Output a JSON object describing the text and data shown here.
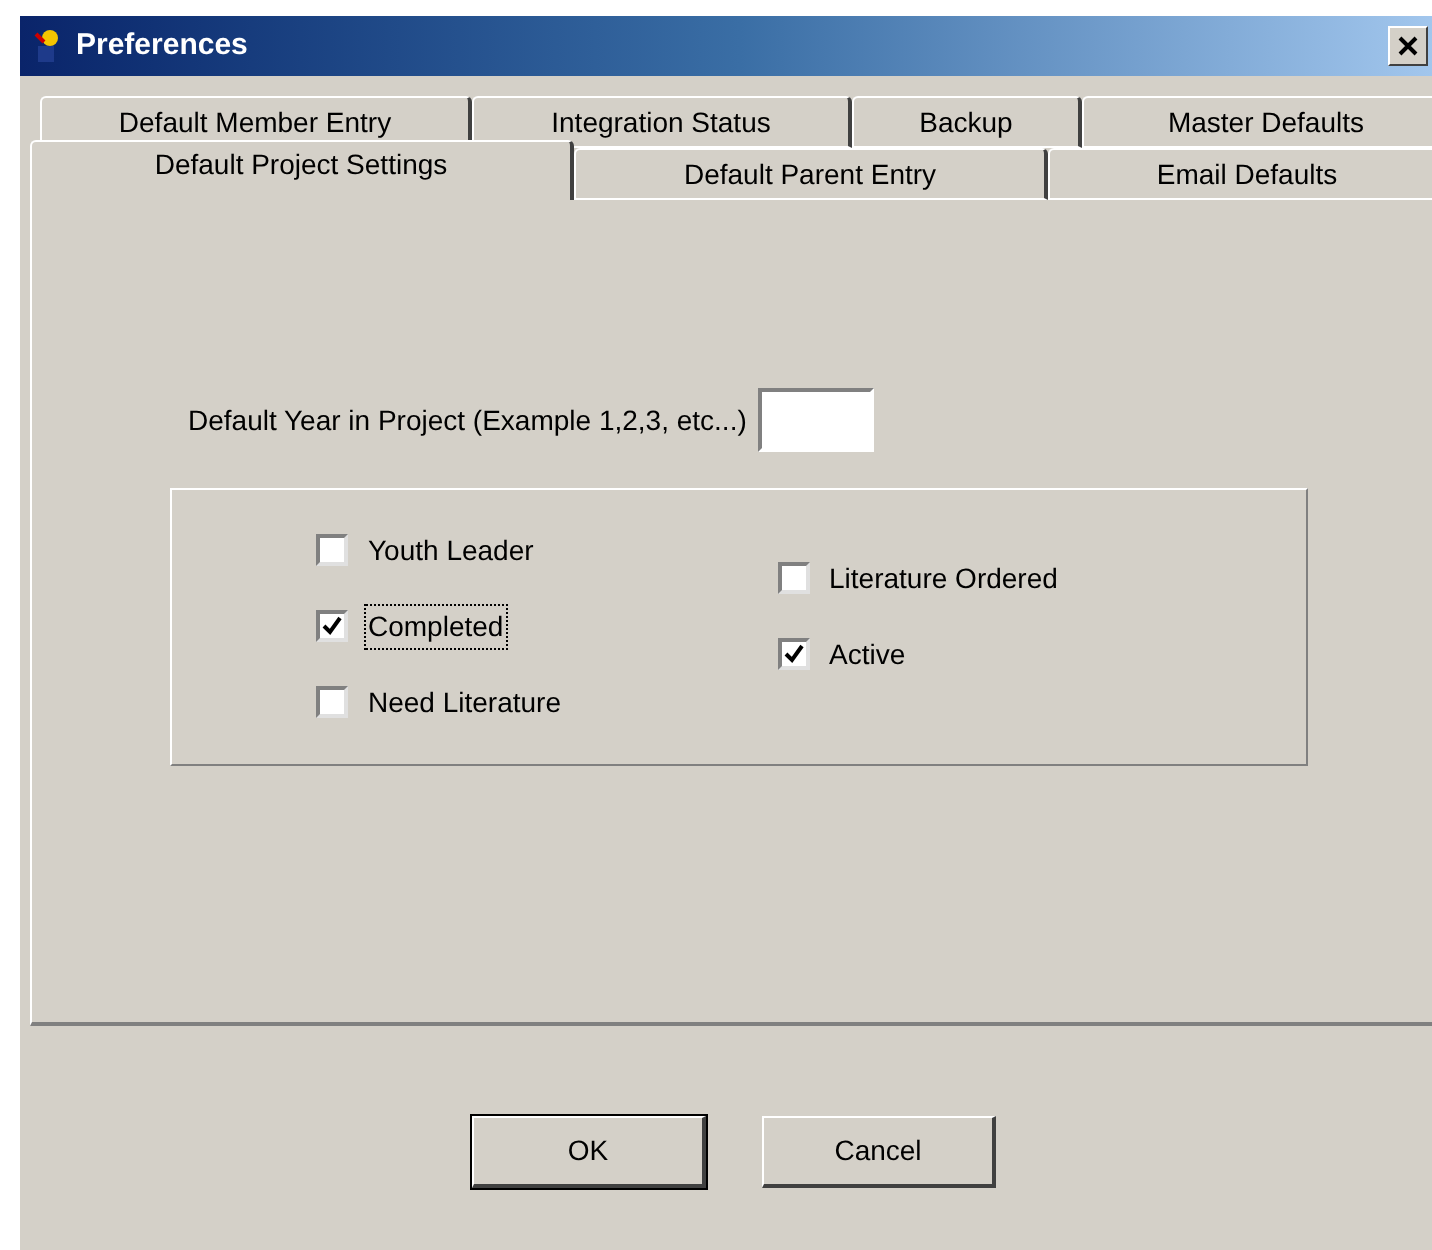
{
  "window": {
    "title": "Preferences"
  },
  "tab_rows": [
    {
      "tabs": [
        {
          "label": "Default Member Entry",
          "selected": false
        },
        {
          "label": "Integration Status",
          "selected": false
        },
        {
          "label": "Backup",
          "selected": false
        },
        {
          "label": "Master Defaults",
          "selected": false
        }
      ]
    },
    {
      "tabs": [
        {
          "label": "Default Project Settings",
          "selected": true
        },
        {
          "label": "Default Parent Entry",
          "selected": false
        },
        {
          "label": "Email Defaults",
          "selected": false
        }
      ]
    }
  ],
  "year_field": {
    "label": "Default Year in Project (Example 1,2,3, etc...)"
  },
  "checkbox_columns": [
    {
      "checkboxes": [
        {
          "label": "Youth Leader",
          "checked": false,
          "focused": false
        },
        {
          "label": "Completed",
          "checked": true,
          "focused": true
        },
        {
          "label": "Need Literature",
          "checked": false,
          "focused": false
        }
      ]
    },
    {
      "checkboxes": [
        {
          "label": "Literature Ordered",
          "checked": false,
          "focused": false
        },
        {
          "label": "Active",
          "checked": true,
          "focused": false
        }
      ]
    }
  ],
  "buttons": [
    {
      "label": "OK",
      "default": true
    },
    {
      "label": "Cancel",
      "default": false
    }
  ]
}
